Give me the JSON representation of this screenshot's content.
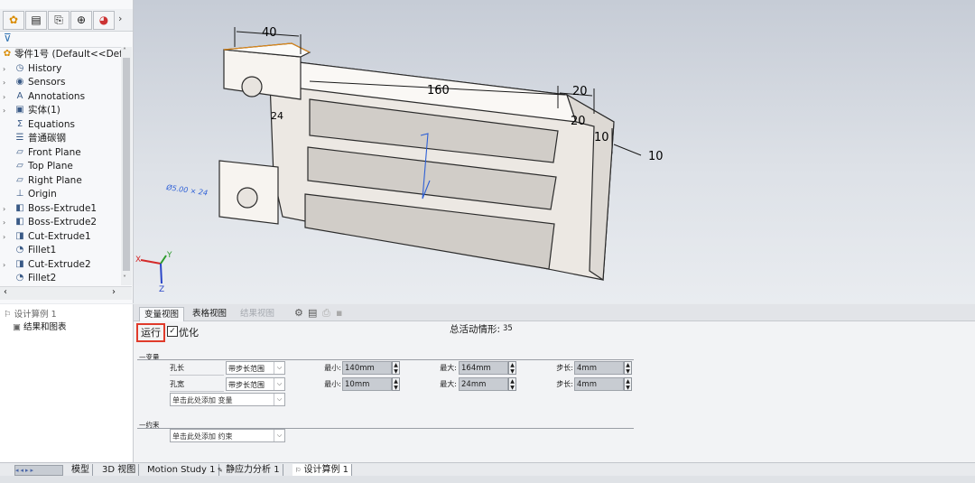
{
  "feature_tree": {
    "top_tab_icons": [
      "feature-manager-icon",
      "property-manager-icon",
      "configuration-manager-icon",
      "dimxpert-icon",
      "display-manager-icon"
    ],
    "items": [
      {
        "label": "零件1号  (Default<<Defau",
        "icon": "part-icon",
        "expand": ""
      },
      {
        "label": "History",
        "icon": "history-icon",
        "expand": "›"
      },
      {
        "label": "Sensors",
        "icon": "sensors-icon",
        "expand": "›"
      },
      {
        "label": "Annotations",
        "icon": "annotations-icon",
        "expand": "›"
      },
      {
        "label": "实体(1)",
        "icon": "solid-bodies-icon",
        "expand": "›"
      },
      {
        "label": "Equations",
        "icon": "equations-icon",
        "expand": ""
      },
      {
        "label": "普通碳钢",
        "icon": "material-icon",
        "expand": ""
      },
      {
        "label": "Front Plane",
        "icon": "plane-icon",
        "expand": ""
      },
      {
        "label": "Top Plane",
        "icon": "plane-icon",
        "expand": ""
      },
      {
        "label": "Right Plane",
        "icon": "plane-icon",
        "expand": ""
      },
      {
        "label": "Origin",
        "icon": "origin-icon",
        "expand": ""
      },
      {
        "label": "Boss-Extrude1",
        "icon": "boss-extrude-icon",
        "expand": "›"
      },
      {
        "label": "Boss-Extrude2",
        "icon": "boss-extrude-icon",
        "expand": "›"
      },
      {
        "label": "Cut-Extrude1",
        "icon": "cut-extrude-icon",
        "expand": "›"
      },
      {
        "label": "Fillet1",
        "icon": "fillet-icon",
        "expand": ""
      },
      {
        "label": "Cut-Extrude2",
        "icon": "cut-extrude-icon",
        "expand": "›"
      },
      {
        "label": "Fillet2",
        "icon": "fillet-icon",
        "expand": ""
      }
    ]
  },
  "model_view": {
    "dims": [
      "40",
      "160",
      "20",
      "20",
      "10",
      "10",
      "24"
    ],
    "sketch_note": "Ø5.00 × 24",
    "axes": {
      "x": "X",
      "y": "Y",
      "z": "Z"
    }
  },
  "study_tree": {
    "items": [
      "设计算例 1",
      "结果和图表"
    ]
  },
  "design_study": {
    "tabs": [
      "变量视图",
      "表格视图",
      "结果视图"
    ],
    "run_label": "运行",
    "optimize_label": "优化",
    "total_scenarios_label": "总活动情形:",
    "total_scenarios_value": "35",
    "variables_header": "变量",
    "variables": [
      {
        "name": "孔长",
        "type": "带步长范围",
        "min_label": "最小:",
        "min": "140mm",
        "max_label": "最大:",
        "max": "164mm",
        "step_label": "步长:",
        "step": "4mm"
      },
      {
        "name": "孔宽",
        "type": "带步长范围",
        "min_label": "最小:",
        "min": "10mm",
        "max_label": "最大:",
        "max": "24mm",
        "step_label": "步长:",
        "step": "4mm"
      }
    ],
    "add_variable": "单击此处添加 变量",
    "constraints_header": "约束",
    "add_constraint": "单击此处添加 约束"
  },
  "bottom_tabs": [
    "模型",
    "3D 视图",
    "Motion Study 1",
    "静应力分析 1",
    "设计算例 1"
  ]
}
